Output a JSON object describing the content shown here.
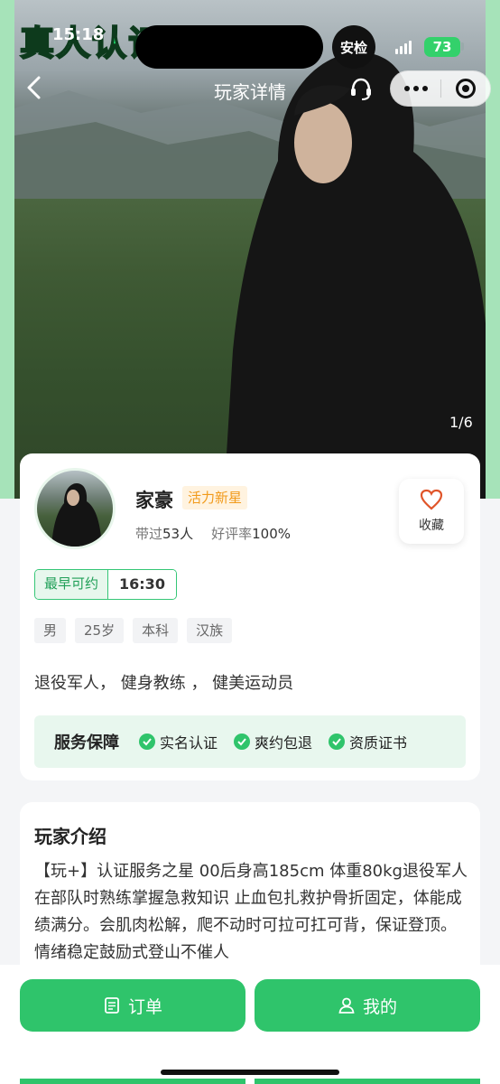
{
  "overlay": {
    "badge_title": "真人认证"
  },
  "status_bar": {
    "time": "15:18",
    "security_label": "安检",
    "battery": "73"
  },
  "nav": {
    "title": "玩家详情"
  },
  "photo": {
    "counter": "1/6"
  },
  "profile": {
    "name": "家豪",
    "level_tag": "活力新星",
    "stats": {
      "served_prefix": "带过",
      "served_count": "53人",
      "rating_prefix": "好评率",
      "rating": "100%"
    },
    "favorite_label": "收藏",
    "earliest": {
      "label": "最早可约",
      "time": "16:30"
    },
    "tags": [
      "男",
      "25岁",
      "本科",
      "汉族"
    ],
    "bio_line": "退役军人， 健身教练 ， 健美运动员",
    "guarantee": {
      "title": "服务保障",
      "items": [
        "实名认证",
        "爽约包退",
        "资质证书"
      ]
    }
  },
  "intro": {
    "title": "玩家介绍",
    "text": "【玩+】认证服务之星 00后身高185cm 体重80kg退役军人 在部队时熟练掌握急救知识 止血包扎救护骨折固定，体能成绩满分。会肌肉松解，爬不动时可拉可扛可背，保证登顶。情绪稳定鼓励式登山不催人"
  },
  "bottom": {
    "orders_label": "订单",
    "mine_label": "我的"
  },
  "colors": {
    "accent": "#2fc46b",
    "tag_orange": "#f19a1a",
    "guarantee_bg": "#e8f7ee"
  },
  "icons": [
    "back-icon",
    "headset-icon",
    "more-icon",
    "close-icon",
    "heart-icon",
    "check-icon",
    "order-list-icon",
    "person-icon",
    "plane-icon"
  ]
}
